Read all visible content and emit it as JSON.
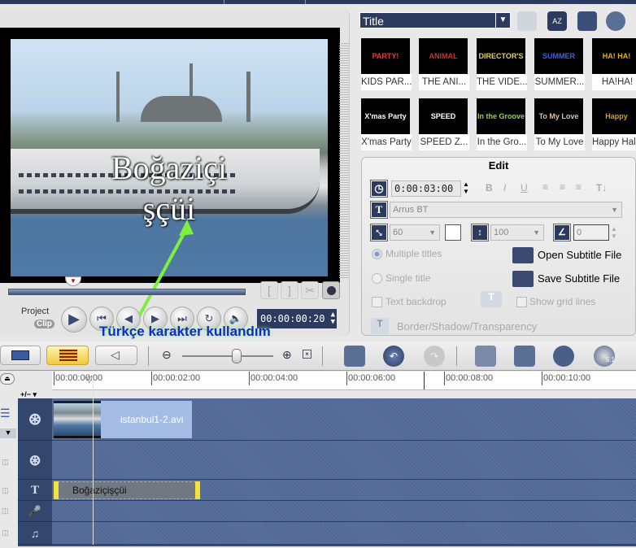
{
  "preview": {
    "title_line1": "Boğaziçi",
    "title_line2": "şçüi",
    "timecode": "00:00:00:20",
    "project_label": "Project",
    "clip_label": "Clip",
    "annotation": "Türkçe karakter kullandım",
    "trim_buttons": [
      "[",
      "]"
    ],
    "playback_buttons": [
      "play",
      "home",
      "previous-frame",
      "next-frame",
      "end",
      "repeat",
      "volume"
    ]
  },
  "library": {
    "category": "Title",
    "items": [
      {
        "label": "KIDS PAR...",
        "preview": "PARTY!",
        "color": "#e04040"
      },
      {
        "label": "THE ANI...",
        "preview": "ANIMAL",
        "color": "#d03030"
      },
      {
        "label": "THE VIDE...",
        "preview": "DIRECTOR'S CUT",
        "color": "#e0d060"
      },
      {
        "label": "SUMMER...",
        "preview": "SUMMER FUN",
        "color": "#4060e0"
      },
      {
        "label": "HA!HA!",
        "preview": "HA! HA!",
        "color": "#e0b020"
      },
      {
        "label": "X'mas Party",
        "preview": "X'mas Party",
        "color": "#ffffff"
      },
      {
        "label": "SPEED Z...",
        "preview": "SPEED",
        "color": "#ffffff"
      },
      {
        "label": "In the Gro...",
        "preview": "In the Groove",
        "color": "#9ad050"
      },
      {
        "label": "To My Love",
        "preview": "To My Love",
        "color": "#e0c0a0"
      },
      {
        "label": "Happy Hal...",
        "preview": "Happy Halloween",
        "color": "#d0a040"
      }
    ]
  },
  "edit": {
    "heading": "Edit",
    "duration": "0:00:03:00",
    "font": "Arrus BT",
    "font_size": "60",
    "line_spacing": "100",
    "angle": "0",
    "multiple_titles": "Multiple titles",
    "single_title": "Single title",
    "text_backdrop": "Text backdrop",
    "show_grid_lines": "Show grid lines",
    "border_shadow": "Border/Shadow/Transparency",
    "open_subtitle": "Open Subtitle File",
    "save_subtitle": "Save Subtitle File",
    "format_buttons": [
      "B",
      "I",
      "U"
    ]
  },
  "toolbar": {
    "zoom_level_fraction": 0.6
  },
  "ruler": {
    "ticks": [
      "00:00:00:00",
      "00:00:02:00",
      "00:00:04:00",
      "00:00:06:00",
      "00:00:08:00",
      "00:00:10:00"
    ]
  },
  "timeline": {
    "track_control": "+/− ▾",
    "video_clip": "istanbul1-2.avi",
    "title_clip": "Boğaziçişçüi"
  }
}
